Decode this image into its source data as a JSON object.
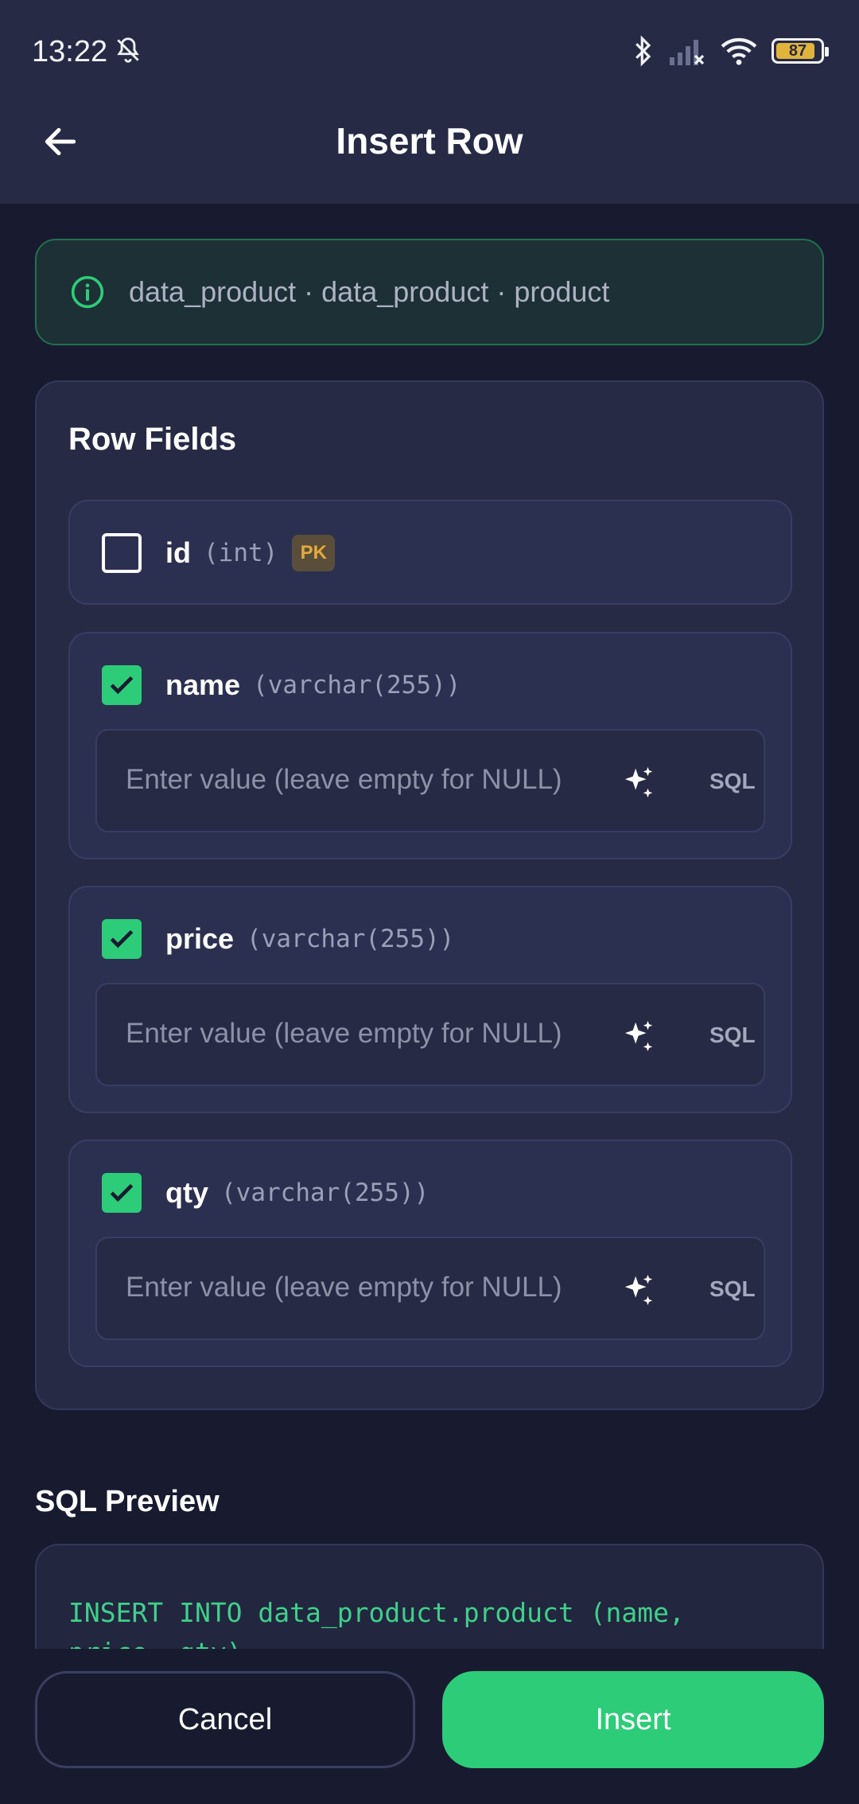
{
  "status_bar": {
    "time": "13:22",
    "battery": "87",
    "icons": [
      "bell-off-icon",
      "bluetooth-icon",
      "signal-icon",
      "wifi-icon",
      "battery-icon"
    ]
  },
  "app_bar": {
    "title": "Insert Row",
    "back_icon": "arrow-left-icon"
  },
  "banner": {
    "text": "data_product · data_product · product",
    "icon": "info-icon"
  },
  "row_fields": {
    "title": "Row Fields",
    "fields": [
      {
        "name": "id",
        "type": "(int)",
        "checked": false,
        "badge": "PK"
      },
      {
        "name": "name",
        "type": "(varchar(255))",
        "checked": true,
        "placeholder": "Enter value (leave empty for NULL)",
        "sql_label": "SQL"
      },
      {
        "name": "price",
        "type": "(varchar(255))",
        "checked": true,
        "placeholder": "Enter value (leave empty for NULL)",
        "sql_label": "SQL"
      },
      {
        "name": "qty",
        "type": "(varchar(255))",
        "checked": true,
        "placeholder": "Enter value (leave empty for NULL)",
        "sql_label": "SQL"
      }
    ]
  },
  "sql_preview": {
    "title": "SQL Preview",
    "code": "INSERT INTO data_product.product (name,\nprice, qty)"
  },
  "actions": {
    "cancel_label": "Cancel",
    "insert_label": "Insert"
  },
  "colors": {
    "accent": "#2dcc79",
    "background": "#181b30",
    "surface": "#262a45",
    "pk_badge": "#e6a93a"
  }
}
